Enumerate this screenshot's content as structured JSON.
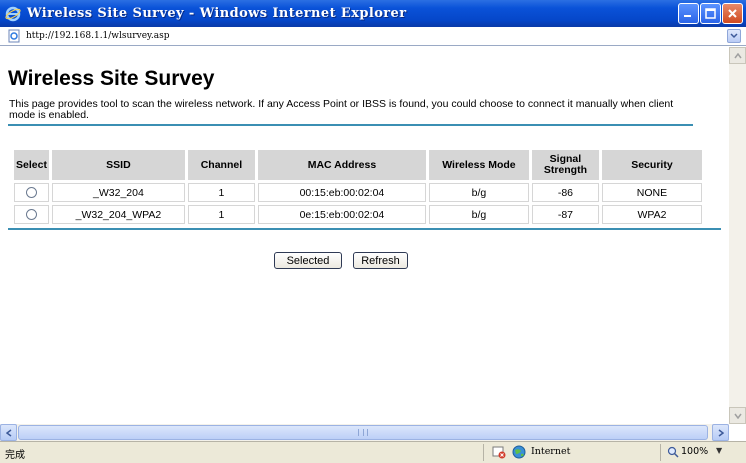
{
  "window": {
    "title": "Wireless Site Survey - Windows Internet Explorer"
  },
  "address_bar": {
    "url": "http://192.168.1.1/wlsurvey.asp"
  },
  "page": {
    "title": "Wireless Site Survey",
    "description": "This page provides tool to scan the wireless network. If any Access Point or IBSS is found, you could choose to connect it manually when client mode is enabled."
  },
  "table": {
    "headers": {
      "select": "Select",
      "ssid": "SSID",
      "channel": "Channel",
      "mac": "MAC Address",
      "mode": "Wireless Mode",
      "signal": "Signal Strength",
      "security": "Security"
    },
    "rows": [
      {
        "ssid": "_W32_204",
        "channel": "1",
        "mac": "00:15:eb:00:02:04",
        "mode": "b/g",
        "signal": "-86",
        "security": "NONE"
      },
      {
        "ssid": "_W32_204_WPA2",
        "channel": "1",
        "mac": "0e:15:eb:00:02:04",
        "mode": "b/g",
        "signal": "-87",
        "security": "WPA2"
      }
    ]
  },
  "buttons": {
    "selected": "Selected",
    "refresh": "Refresh"
  },
  "status_bar": {
    "status": "完成",
    "zone": "Internet",
    "zoom": "100%"
  },
  "colors": {
    "titlebar": "#0a52d8",
    "rule": "#3b8fb3",
    "header_cell": "#d6d6d6",
    "statusbar": "#ece9d8"
  }
}
